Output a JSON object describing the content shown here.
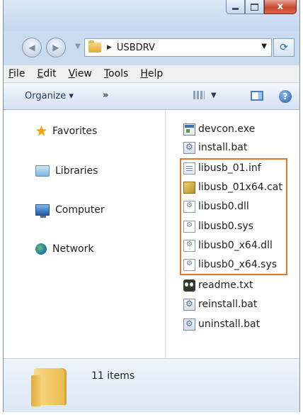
{
  "window": {
    "caption_buttons": [
      {
        "name": "minimize",
        "icon": "minimize-icon"
      },
      {
        "name": "maximize",
        "icon": "maximize-icon"
      },
      {
        "name": "close",
        "icon": "close-icon",
        "glyph": "x"
      }
    ]
  },
  "navigation": {
    "back_icon": "back-arrow-icon",
    "forward_icon": "forward-arrow-icon",
    "address": {
      "folder_icon": "folder-icon",
      "separator": "▶",
      "path": "USBDRV"
    },
    "refresh_icon": "refresh-icon"
  },
  "menu": {
    "items": [
      {
        "accel": "F",
        "rest": "ile"
      },
      {
        "accel": "E",
        "rest": "dit"
      },
      {
        "accel": "V",
        "rest": "iew"
      },
      {
        "accel": "T",
        "rest": "ools"
      },
      {
        "accel": "H",
        "rest": "elp"
      }
    ]
  },
  "toolbar": {
    "organize": "Organize ▾",
    "more": "»",
    "views_icon": "change-view-icon",
    "preview_icon": "preview-pane-icon",
    "help_icon": "help-icon",
    "help_glyph": "?"
  },
  "nav_pane": {
    "items": [
      {
        "label": "Favorites",
        "icon": "star-icon"
      },
      {
        "label": "Libraries",
        "icon": "libraries-icon"
      },
      {
        "label": "Computer",
        "icon": "computer-icon"
      },
      {
        "label": "Network",
        "icon": "network-icon"
      }
    ]
  },
  "files": [
    {
      "name": "devcon.exe",
      "icon": "exe-icon"
    },
    {
      "name": "install.bat",
      "icon": "bat-icon"
    },
    {
      "name": "libusb_01.inf",
      "icon": "inf-icon"
    },
    {
      "name": "libusb_01x64.cat",
      "icon": "catalog-icon"
    },
    {
      "name": "libusb0.dll",
      "icon": "dll-icon"
    },
    {
      "name": "libusb0.sys",
      "icon": "sys-icon"
    },
    {
      "name": "libusb0_x64.dll",
      "icon": "dll-icon"
    },
    {
      "name": "libusb0_x64.sys",
      "icon": "sys-icon"
    },
    {
      "name": "readme.txt",
      "icon": "txt-icon"
    },
    {
      "name": "reinstall.bat",
      "icon": "bat-icon"
    },
    {
      "name": "uninstall.bat",
      "icon": "bat-icon"
    }
  ],
  "highlight_color": "#e6782d",
  "status": {
    "icon": "folder-icon",
    "text": "11 items"
  }
}
